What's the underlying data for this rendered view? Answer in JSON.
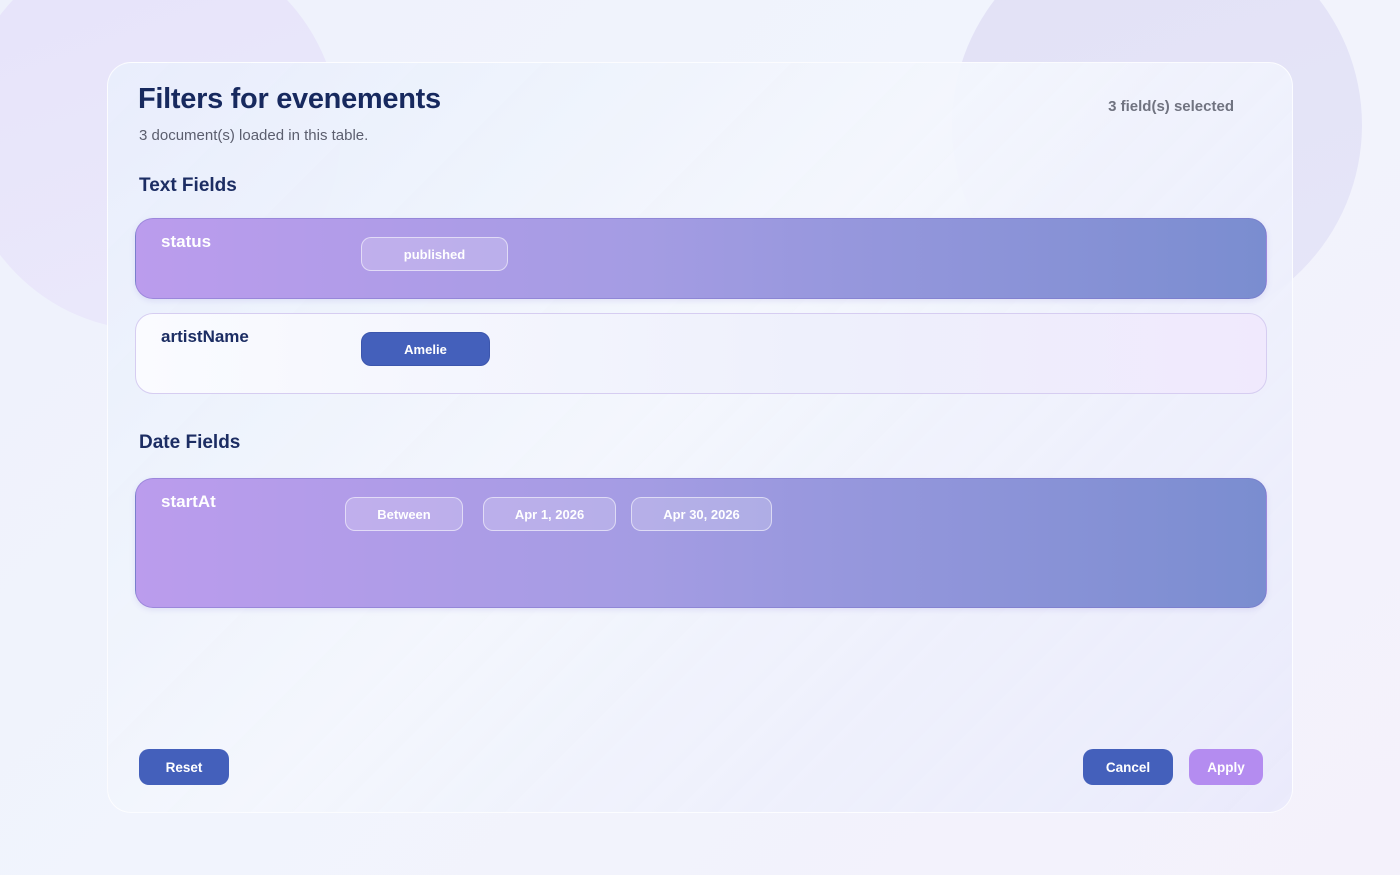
{
  "header": {
    "title": "Filters for evenements",
    "subtitle": "3 document(s) loaded in this table.",
    "selected_count": "3 field(s) selected"
  },
  "sections": {
    "text": {
      "heading": "Text Fields",
      "fields": [
        {
          "name": "status",
          "active": true,
          "values": [
            "published"
          ]
        },
        {
          "name": "artistName",
          "active": false,
          "values": [
            "Amelie"
          ]
        }
      ]
    },
    "date": {
      "heading": "Date Fields",
      "fields": [
        {
          "name": "startAt",
          "active": true,
          "operator": "Between",
          "from": "Apr 1, 2026",
          "to": "Apr 30, 2026"
        }
      ]
    }
  },
  "footer": {
    "reset_label": "Reset",
    "cancel_label": "Cancel",
    "apply_label": "Apply"
  },
  "colors": {
    "primary": "#4460bb",
    "accent": "#b48cf0",
    "title": "#17295e",
    "active_card_gradient_start": "#bb9ced",
    "active_card_gradient_end": "#7a8dd0"
  }
}
